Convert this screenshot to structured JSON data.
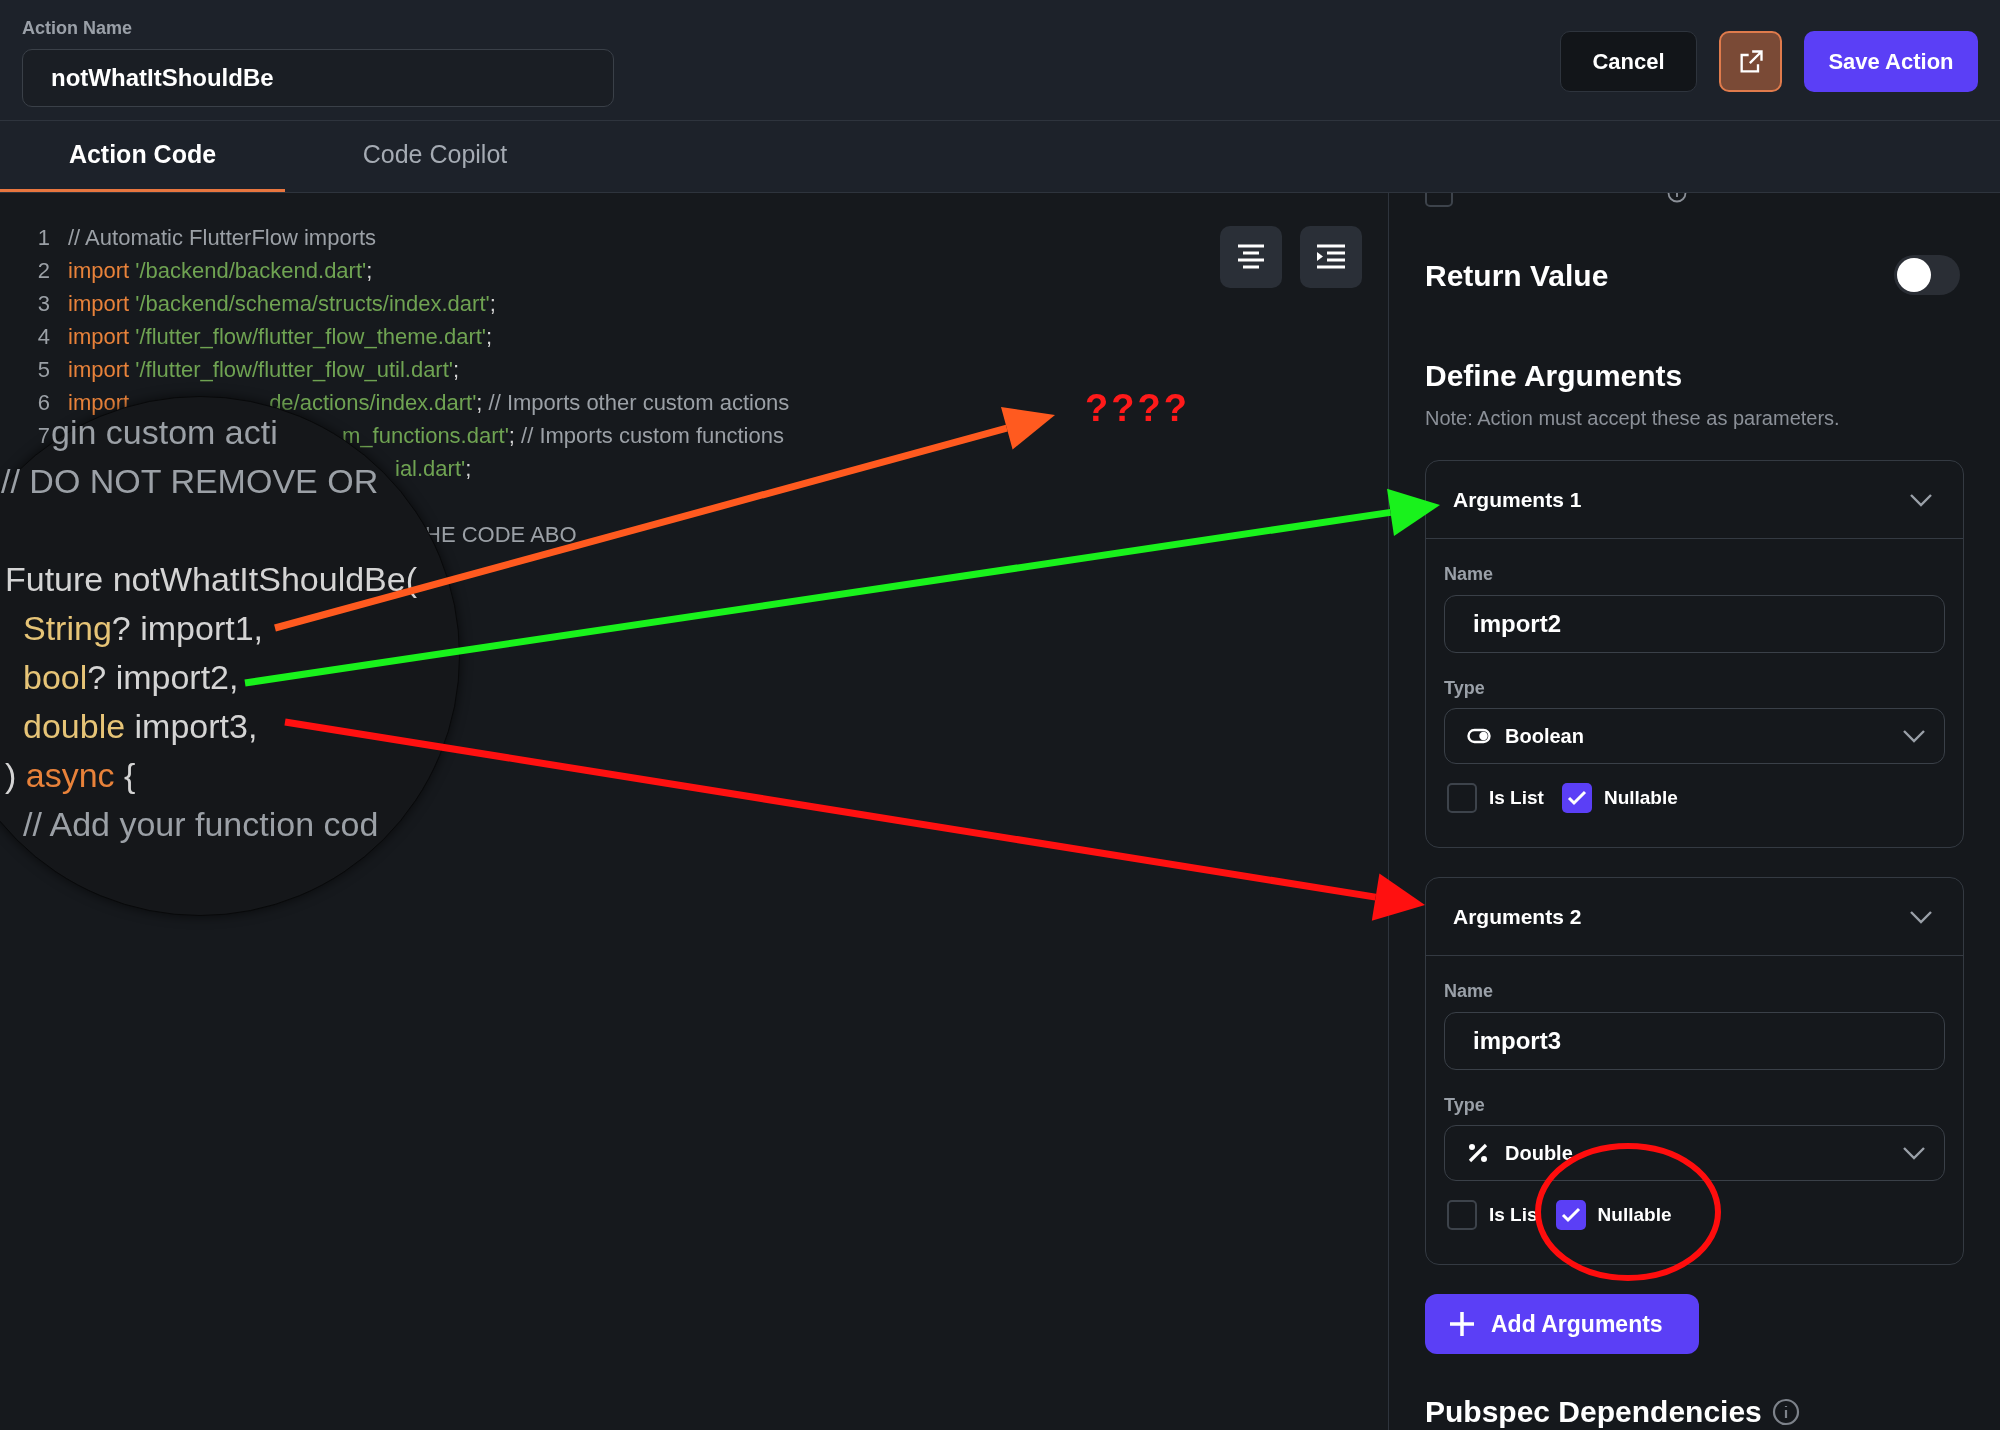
{
  "header": {
    "label": "Action Name",
    "value": "notWhatItShouldBe",
    "cancel": "Cancel",
    "save": "Save Action"
  },
  "tabs": [
    {
      "label": "Action Code",
      "selected": true
    },
    {
      "label": "Code Copilot",
      "selected": false
    }
  ],
  "code_lines": [
    {
      "number": "1",
      "segments": [
        {
          "kind": "comment",
          "text": "// Automatic FlutterFlow imports"
        }
      ]
    },
    {
      "number": "2",
      "segments": [
        {
          "kind": "keyword",
          "text": "import"
        },
        {
          "kind": "string",
          "text": " '/backend/backend.dart'"
        },
        {
          "kind": "plain",
          "text": ";"
        }
      ]
    },
    {
      "number": "3",
      "segments": [
        {
          "kind": "keyword",
          "text": "import"
        },
        {
          "kind": "string",
          "text": " '/backend/schema/structs/index.dart'"
        },
        {
          "kind": "plain",
          "text": ";"
        }
      ]
    },
    {
      "number": "4",
      "segments": [
        {
          "kind": "keyword",
          "text": "import"
        },
        {
          "kind": "string",
          "text": " '/flutter_flow/flutter_flow_theme.dart'"
        },
        {
          "kind": "plain",
          "text": ";"
        }
      ]
    },
    {
      "number": "5",
      "segments": [
        {
          "kind": "keyword",
          "text": "import"
        },
        {
          "kind": "string",
          "text": " '/flutter_flow/flutter_flow_util.dart'"
        },
        {
          "kind": "plain",
          "text": ";"
        }
      ]
    },
    {
      "number": "6",
      "segments": [
        {
          "kind": "keyword",
          "text": "import"
        },
        {
          "kind": "gap"
        },
        {
          "kind": "string",
          "text": "de/actions/index.dart'"
        },
        {
          "kind": "plain",
          "text": "; "
        },
        {
          "kind": "comment",
          "text": "// Imports other custom actions"
        }
      ]
    },
    {
      "number": "7",
      "segments": [
        {
          "kind": "gap"
        },
        {
          "kind": "string",
          "text": "m_functions.dart'"
        },
        {
          "kind": "plain",
          "text": "; "
        },
        {
          "kind": "comment",
          "text": "// Imports custom functions"
        }
      ]
    },
    {
      "segments": [
        {
          "kind": "gap"
        },
        {
          "kind": "string",
          "text": "ial.dart'"
        },
        {
          "kind": "plain",
          "text": ";"
        }
      ]
    },
    {
      "segments": [
        {
          "kind": "gap"
        },
        {
          "kind": "comment",
          "text": "HE CODE ABO"
        }
      ]
    }
  ],
  "magnifier": {
    "lines": [
      {
        "segments": [
          {
            "kind": "comment",
            "text": "gin custom acti"
          }
        ]
      },
      {
        "segments": [
          {
            "kind": "comment",
            "text": "// DO NOT REMOVE OR"
          }
        ]
      },
      {
        "segments": [
          {
            "kind": "plain",
            "text": "Future notWhatItShouldBe("
          }
        ]
      },
      {
        "segments": [
          {
            "kind": "type",
            "text": "String"
          },
          {
            "kind": "plain",
            "text": "? import1,"
          }
        ]
      },
      {
        "segments": [
          {
            "kind": "type",
            "text": "bool"
          },
          {
            "kind": "plain",
            "text": "? import2,"
          }
        ]
      },
      {
        "segments": [
          {
            "kind": "type",
            "text": "double"
          },
          {
            "kind": "plain",
            "text": " import3,"
          }
        ]
      },
      {
        "segments": [
          {
            "kind": "plain",
            "text": ") "
          },
          {
            "kind": "keyword",
            "text": "async"
          },
          {
            "kind": "plain",
            "text": " {"
          }
        ]
      },
      {
        "segments": [
          {
            "kind": "comment",
            "text": "// Add your function cod"
          }
        ]
      }
    ]
  },
  "panel": {
    "include_build_context": {
      "checked": false
    },
    "return_value": {
      "label": "Return Value",
      "on": false
    },
    "define_title": "Define Arguments",
    "define_note": "Note: Action must accept these as parameters.",
    "arguments": [
      {
        "title": "Arguments 1",
        "name_label": "Name",
        "name": "import2",
        "type_label": "Type",
        "type": "Boolean",
        "kind": "boolean",
        "options": [
          {
            "label": "Is List",
            "checked": false
          },
          {
            "label": "Nullable",
            "checked": true
          }
        ]
      },
      {
        "title": "Arguments 2",
        "name_label": "Name",
        "name": "import3",
        "type_label": "Type",
        "type": "Double",
        "kind": "double",
        "options": [
          {
            "label": "Is Lis",
            "checked": false
          },
          {
            "label": "Nullable",
            "checked": true
          }
        ]
      }
    ],
    "add_button": "Add Arguments",
    "pubspec_title": "Pubspec Dependencies"
  },
  "annotations": {
    "question_marks": "????",
    "arrows": [
      {
        "color": "#ff5a1f"
      },
      {
        "color": "#19f21c"
      },
      {
        "color": "#ff1010"
      }
    ]
  }
}
